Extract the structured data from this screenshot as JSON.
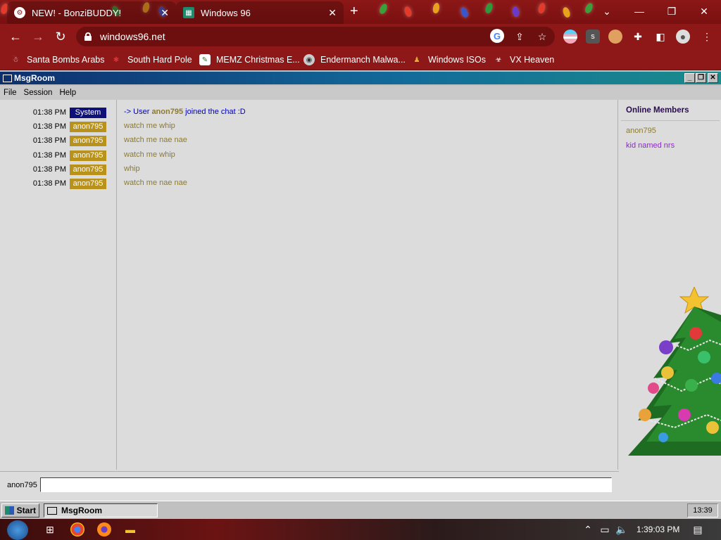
{
  "browser": {
    "tabs": [
      {
        "title": "NEW! - BonziBUDDY!",
        "close": "✕"
      },
      {
        "title": "Windows 96",
        "close": "✕"
      }
    ],
    "new_tab": "+",
    "window_controls": {
      "dropdown": "⌄",
      "minimize": "—",
      "restore": "❐",
      "close": "✕"
    },
    "url": "windows96.net",
    "bookmarks": [
      {
        "label": "Santa Bombs Arabs"
      },
      {
        "label": "South Hard Pole"
      },
      {
        "label": "MEMZ Christmas E..."
      },
      {
        "label": "Endermanch Malwa..."
      },
      {
        "label": "Windows ISOs"
      },
      {
        "label": "VX Heaven"
      }
    ],
    "profile_badge": "s"
  },
  "msgroom": {
    "title": "MsgRoom",
    "menu": [
      "File",
      "Session",
      "Help"
    ],
    "messages": [
      {
        "time": "01:38 PM",
        "user": "System",
        "user_color": "#10107a",
        "text_prefix": "-> User",
        "text_user": "anon795",
        "text_suffix": "joined the chat :D"
      },
      {
        "time": "01:38 PM",
        "user": "anon795",
        "user_color": "#b8921a",
        "text": "watch me whip"
      },
      {
        "time": "01:38 PM",
        "user": "anon795",
        "user_color": "#b8921a",
        "text": "watch me nae nae"
      },
      {
        "time": "01:38 PM",
        "user": "anon795",
        "user_color": "#b8921a",
        "text": "watch me whip"
      },
      {
        "time": "01:38 PM",
        "user": "anon795",
        "user_color": "#b8921a",
        "text": "whip"
      },
      {
        "time": "01:38 PM",
        "user": "anon795",
        "user_color": "#b8921a",
        "text": "watch me nae nae"
      }
    ],
    "members_title": "Online Members",
    "members": [
      {
        "name": "anon795",
        "color": "#8b7a33"
      },
      {
        "name": "kid named nrs",
        "color": "#8a2bc2"
      }
    ],
    "input_label": "anon795",
    "input_value": ""
  },
  "w96_taskbar": {
    "start": "Start",
    "task": "MsgRoom",
    "clock": "13:39"
  },
  "win7_taskbar": {
    "time": "1:39:03 PM"
  }
}
